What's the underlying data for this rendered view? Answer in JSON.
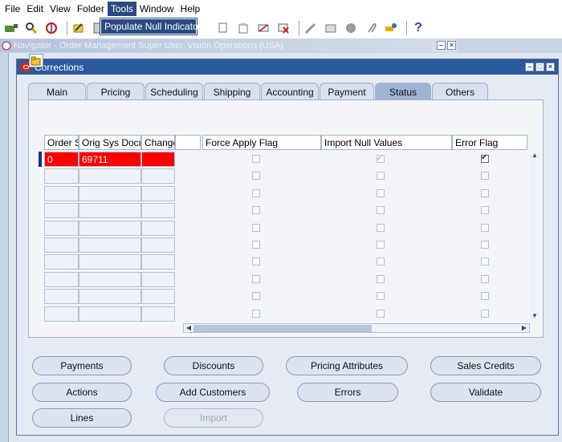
{
  "menu": [
    "File",
    "Edit",
    "View",
    "Folder",
    "Tools",
    "Window",
    "Help"
  ],
  "menu_underline": [
    "F",
    "E",
    "V",
    "F",
    "T",
    "W",
    "H"
  ],
  "dropdown": {
    "item": "Populate Null Indicator"
  },
  "navigator": {
    "title": "Navigator - Order Management Super User, Vision Operations (USA)"
  },
  "window": {
    "title": "Corrections"
  },
  "tabs": [
    "Main",
    "Pricing",
    "Scheduling",
    "Shipping",
    "Accounting",
    "Payment",
    "Status",
    "Others"
  ],
  "active_tab": "Status",
  "grid": {
    "headers": [
      "Order S",
      "Orig Sys Docu",
      "Change",
      "Force Apply Flag",
      "Import Null Values",
      "Error Flag"
    ],
    "first_row": {
      "order_s": "0",
      "orig_sys_doc": "69711",
      "change": ""
    },
    "error_flag_checked_first_row": true,
    "row_count": 10
  },
  "buttons": {
    "payments": "Payments",
    "discounts": "Discounts",
    "pricing_attributes": "Pricing Attributes",
    "sales_credits": "Sales Credits",
    "actions": "Actions",
    "add_customers": "Add Customers",
    "errors": "Errors",
    "validate": "Validate",
    "lines": "Lines",
    "import": "Import"
  },
  "colors": {
    "title_bar": "#2b5a9c",
    "menu_highlight": "#2b4a82",
    "error_cell": "#ff0000",
    "background": "#c8d3e6"
  },
  "icons": [
    "new-record-icon",
    "find-icon",
    "navigator-icon",
    "save-icon",
    "attachment-icon",
    "delete-icon",
    "edit-icon",
    "clear-icon",
    "folder-icon",
    "paperclip-icon",
    "tools-icon",
    "help-icon"
  ]
}
